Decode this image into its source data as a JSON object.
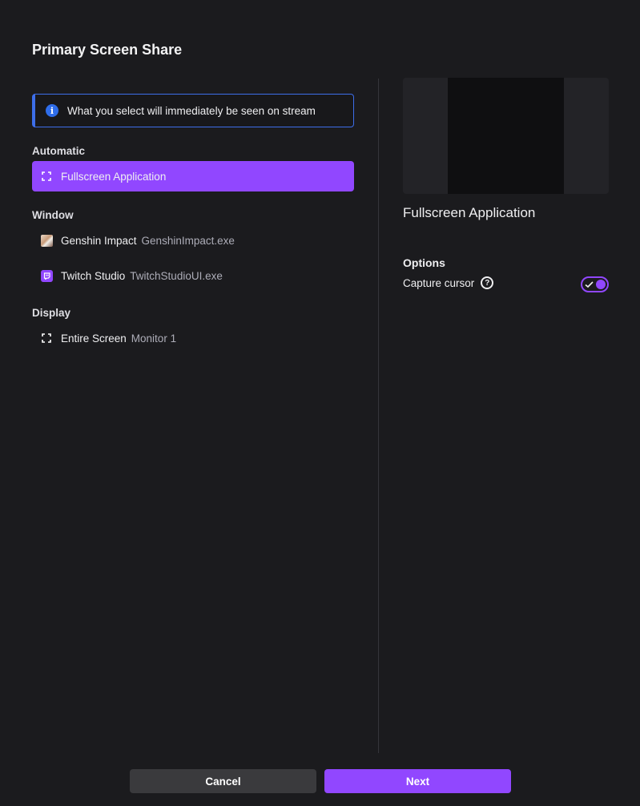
{
  "dialog": {
    "title": "Primary Screen Share"
  },
  "info": {
    "icon": "info-icon",
    "text": "What you select will immediately be seen on stream",
    "color": "#3d6eea"
  },
  "sections": {
    "automatic": {
      "label": "Automatic",
      "items": [
        {
          "name": "Fullscreen Application",
          "icon": "fullscreen-icon",
          "selected": true
        }
      ]
    },
    "window": {
      "label": "Window",
      "items": [
        {
          "name": "Genshin Impact",
          "exe": "GenshinImpact.exe",
          "icon": "genshin-app-icon"
        },
        {
          "name": "Twitch Studio",
          "exe": "TwitchStudioUI.exe",
          "icon": "twitch-studio-icon"
        }
      ]
    },
    "display": {
      "label": "Display",
      "items": [
        {
          "name": "Entire Screen",
          "exe": "Monitor 1",
          "icon": "fullscreen-icon"
        }
      ]
    }
  },
  "preview": {
    "title": "Fullscreen Application"
  },
  "options": {
    "label": "Options",
    "capture_cursor": {
      "label": "Capture cursor",
      "enabled": true
    }
  },
  "footer": {
    "cancel_label": "Cancel",
    "next_label": "Next"
  },
  "colors": {
    "accent": "#9147ff",
    "background": "#1b1b1e",
    "info_border": "#3d6eea"
  }
}
